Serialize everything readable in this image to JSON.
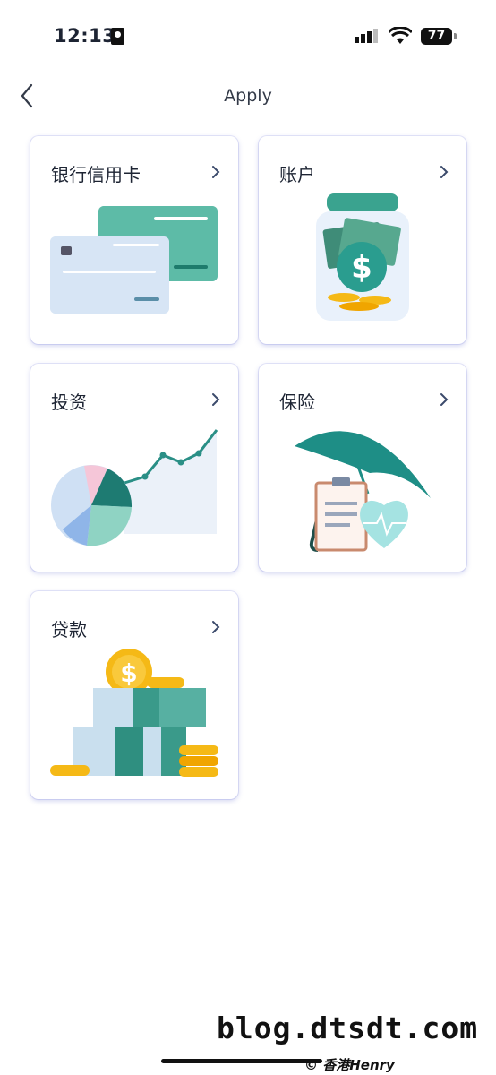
{
  "status": {
    "time": "12:13",
    "battery": "77"
  },
  "nav": {
    "title": "Apply"
  },
  "cards": [
    {
      "title": "银行信用卡"
    },
    {
      "title": "账户"
    },
    {
      "title": "投资"
    },
    {
      "title": "保险"
    },
    {
      "title": "贷款"
    }
  ],
  "watermark": {
    "site": "blog.dtsdt.com",
    "credit": "© 香港Henry"
  },
  "colors": {
    "accent": "#2a9d8f",
    "gold": "#f5b916",
    "navy": "#1d2433"
  }
}
